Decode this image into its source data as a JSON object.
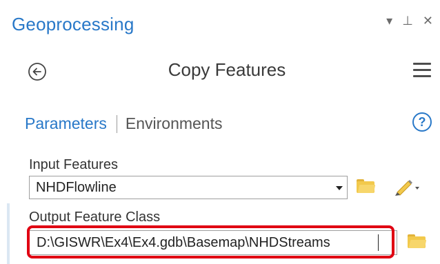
{
  "pane": {
    "title": "Geoprocessing",
    "controls": {
      "options_glyph": "▾",
      "pin_glyph": "⊥",
      "close_glyph": "✕"
    }
  },
  "tool": {
    "title": "Copy Features",
    "back_icon": "back-arrow-icon",
    "menu_icon": "hamburger-menu-icon"
  },
  "tabs": {
    "parameters": "Parameters",
    "environments": "Environments",
    "help_glyph": "?"
  },
  "params": {
    "input_label": "Input Features",
    "input_value": "NHDFlowline",
    "output_label": "Output Feature Class",
    "output_value": "D:\\GISWR\\Ex4\\Ex4.gdb\\Basemap\\NHDStreams"
  },
  "colors": {
    "accent": "#2878c8",
    "highlight": "#e00012",
    "folder": "#f2c94c"
  }
}
